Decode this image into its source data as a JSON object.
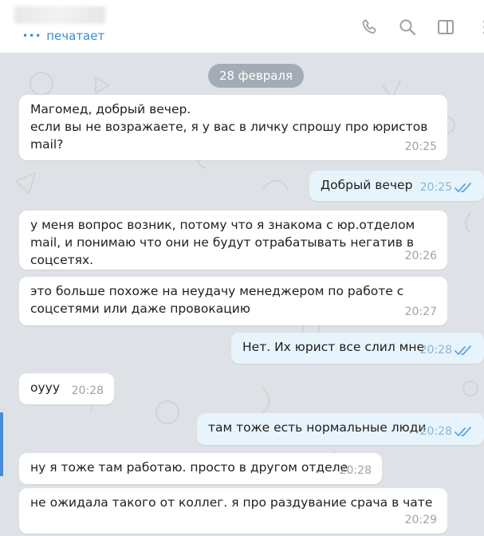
{
  "header": {
    "status": "печатает",
    "icons": [
      "phone-icon",
      "search-icon",
      "sidebar-toggle-icon",
      "more-icon"
    ]
  },
  "chat": {
    "date": "28 февраля",
    "messages": [
      {
        "dir": "in",
        "text": "Магомед, добрый вечер.\nесли вы не возражаете, я у вас в личку спрошу про юристов mail?",
        "time": "20:25"
      },
      {
        "dir": "out",
        "text": "Добрый вечер",
        "time": "20:25",
        "read": true
      },
      {
        "dir": "in",
        "text": "у меня вопрос возник, потому что я знакома с юр.отделом mail, и понимаю что они не будут отрабатывать негатив в соцсетях.",
        "time": "20:26"
      },
      {
        "dir": "in",
        "text": "это больше похоже на неудачу менеджером по работе с соцсетями или даже провокацию",
        "time": "20:27"
      },
      {
        "dir": "out",
        "text": "Нет. Их юрист все слил мне",
        "time": "20:28",
        "read": true
      },
      {
        "dir": "in",
        "text": "оууу",
        "time": "20:28"
      },
      {
        "dir": "out",
        "text": "там тоже есть нормальные люди",
        "time": "20:28",
        "read": true
      },
      {
        "dir": "in",
        "text": "ну я тоже там работаю. просто в другом отделе",
        "time": "20:28"
      },
      {
        "dir": "in",
        "text": "не ожидала такого от коллег. я про раздувание срача в чате",
        "time": "20:29"
      }
    ]
  }
}
